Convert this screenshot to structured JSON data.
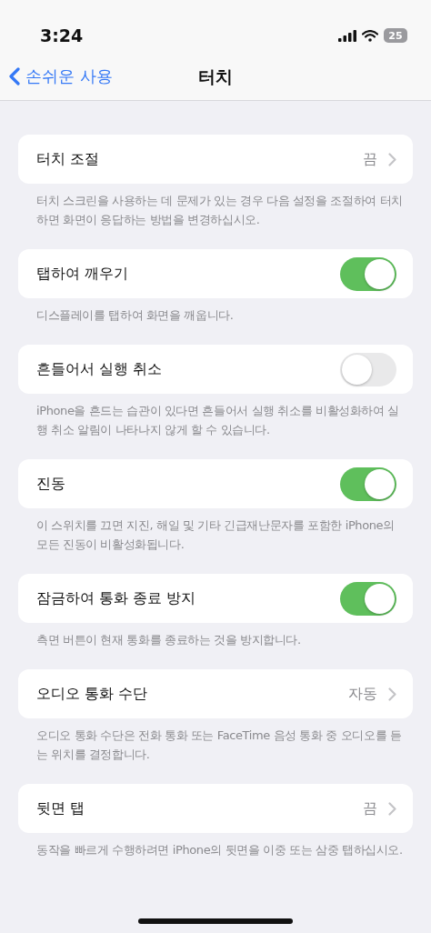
{
  "status_bar": {
    "time": "3:24",
    "battery": "25"
  },
  "nav": {
    "back": "손쉬운 사용",
    "title": "터치"
  },
  "sections": [
    {
      "kind": "link",
      "label": "터치 조절",
      "value": "끔",
      "footer": "터치 스크린을 사용하는 데 문제가 있는 경우 다음 설정을 조절하여 터치하면 화면이 응답하는 방법을 변경하십시오."
    },
    {
      "kind": "toggle",
      "label": "탭하여 깨우기",
      "on": true,
      "footer": "디스플레이를 탭하여 화면을 깨웁니다."
    },
    {
      "kind": "toggle",
      "label": "흔들어서 실행 취소",
      "on": false,
      "footer": "iPhone을 흔드는 습관이 있다면 흔들어서 실행 취소를 비활성화하여 실행 취소 알림이 나타나지 않게 할 수 있습니다."
    },
    {
      "kind": "toggle",
      "label": "진동",
      "on": true,
      "footer": "이 스위치를 끄면 지진, 해일 및 기타 긴급재난문자를 포함한 iPhone의 모든 진동이 비활성화됩니다."
    },
    {
      "kind": "toggle",
      "label": "잠금하여 통화 종료 방지",
      "on": true,
      "footer": "측면 버튼이 현재 통화를 종료하는 것을 방지합니다."
    },
    {
      "kind": "link",
      "label": "오디오 통화 수단",
      "value": "자동",
      "footer": "오디오 통화 수단은 전화 통화 또는 FaceTime 음성 통화 중 오디오를 듣는 위치를 결정합니다."
    },
    {
      "kind": "link",
      "label": "뒷면 탭",
      "value": "끔",
      "footer": "동작을 빠르게 수행하려면 iPhone의 뒷면을 이중 또는 삼중 탭하십시오."
    }
  ]
}
